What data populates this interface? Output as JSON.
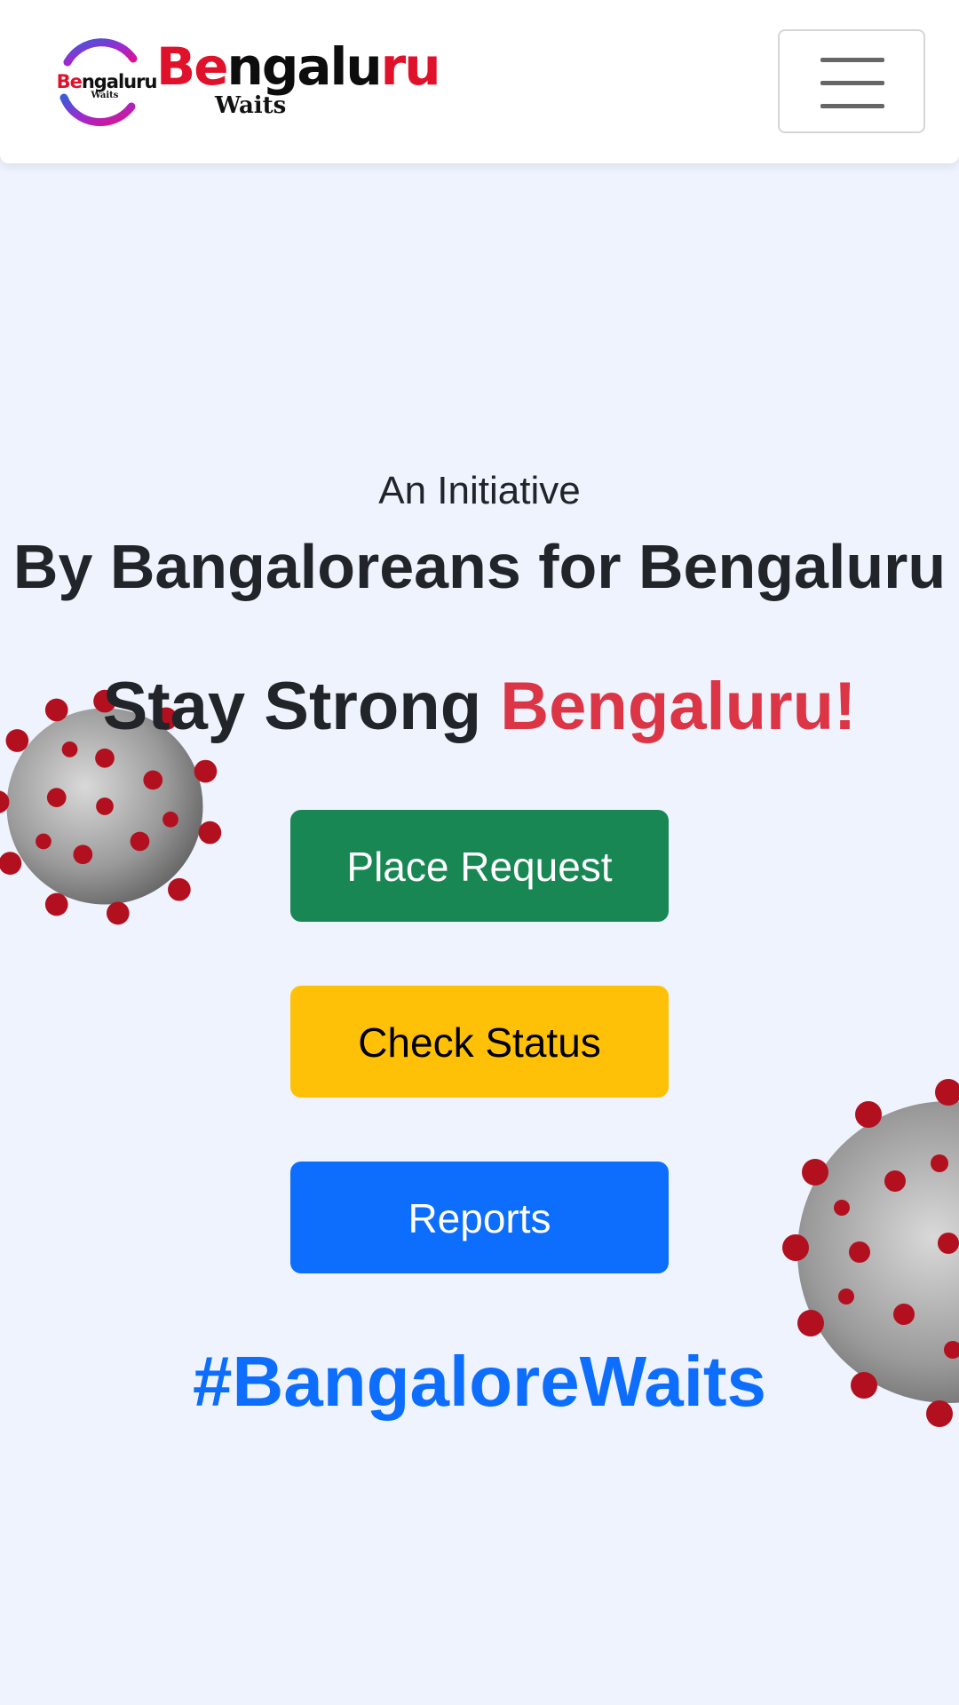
{
  "navbar": {
    "logo": {
      "word_prefix": "Be",
      "word_mid": "ngalu",
      "word_end": "ru",
      "sub": "Waits",
      "small_prefix": "Be",
      "small_rest": "ngaluru",
      "small_sub": "Waits"
    },
    "menu_icon": "hamburger-menu-icon"
  },
  "hero": {
    "subtitle": "An Initiative",
    "title": "By Bangaloreans for Bengaluru",
    "strong_text": "Stay Strong ",
    "strong_accent": "Bengaluru!"
  },
  "actions": {
    "place_request": "Place Request",
    "check_status": "Check Status",
    "reports": "Reports"
  },
  "hashtag": "#BangaloreWaits",
  "colors": {
    "background": "#eef3fd",
    "accent_red": "#dc3545",
    "green": "#198754",
    "yellow": "#ffc107",
    "blue": "#0d6efd"
  },
  "decorations": [
    "virus-image-left",
    "virus-image-right"
  ]
}
